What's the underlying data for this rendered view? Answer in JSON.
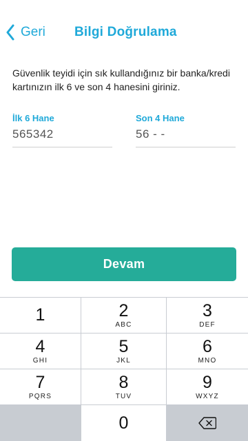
{
  "nav": {
    "back_label": "Geri",
    "title": "Bilgi Doğrulama"
  },
  "description": "Güvenlik teyidi için sık kullandığınız bir banka/kredi kartınızın ilk 6 ve son 4 hanesini giriniz.",
  "fields": {
    "first6": {
      "label": "İlk 6 Hane",
      "value": "565342"
    },
    "last4": {
      "label": "Son 4 Hane",
      "value": "56 - -"
    }
  },
  "continue_label": "Devam",
  "keypad": {
    "keys": [
      {
        "digit": "1",
        "letters": ""
      },
      {
        "digit": "2",
        "letters": "ABC"
      },
      {
        "digit": "3",
        "letters": "DEF"
      },
      {
        "digit": "4",
        "letters": "GHI"
      },
      {
        "digit": "5",
        "letters": "JKL"
      },
      {
        "digit": "6",
        "letters": "MNO"
      },
      {
        "digit": "7",
        "letters": "PQRS"
      },
      {
        "digit": "8",
        "letters": "TUV"
      },
      {
        "digit": "9",
        "letters": "WXYZ"
      },
      {
        "digit": "0",
        "letters": ""
      }
    ],
    "delete_icon": "backspace-icon"
  },
  "colors": {
    "accent": "#1fa9d9",
    "button": "#25ac99",
    "keypad_bg": "#c8ccd2"
  }
}
